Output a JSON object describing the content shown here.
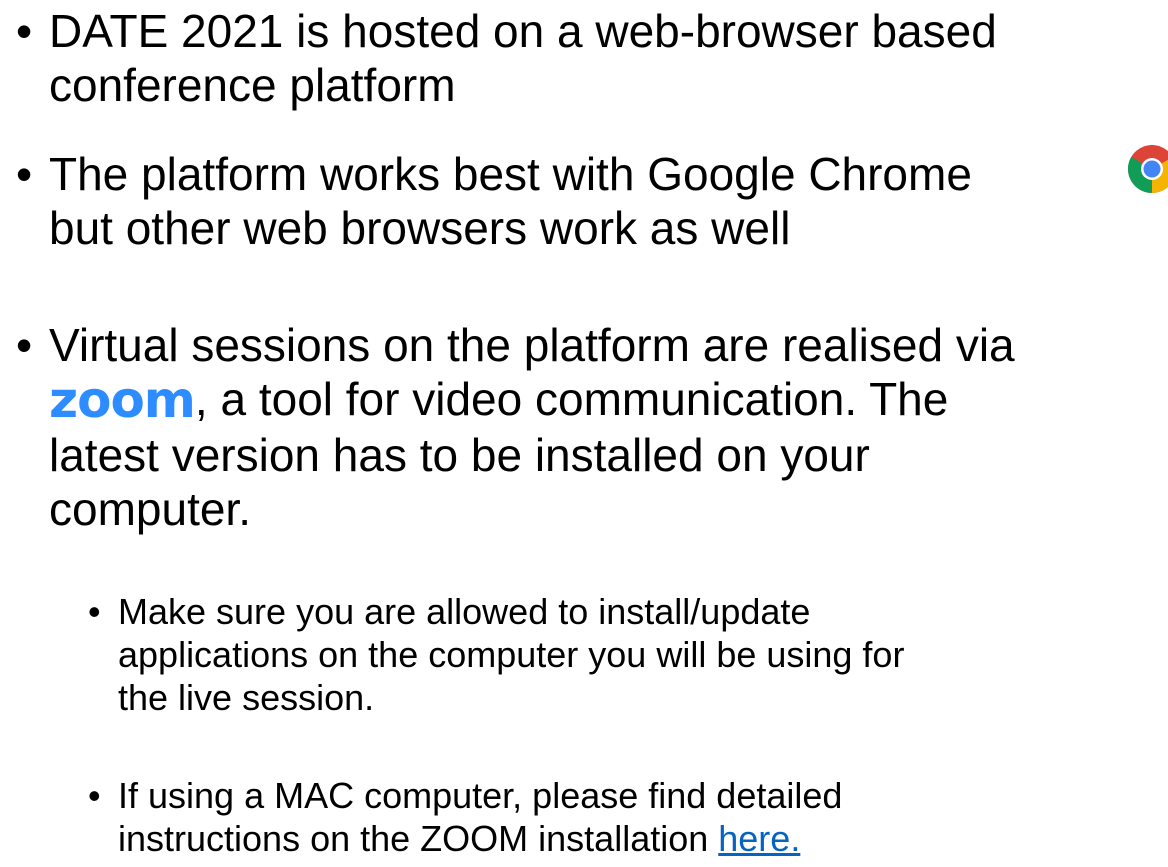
{
  "bullets": [
    {
      "lines": [
        "DATE 2021 is hosted on a web-browser based",
        "conference platform"
      ]
    },
    {
      "lines": [
        "The platform works best with Google Chrome",
        "but other web browsers work as well"
      ]
    },
    {
      "line1": "Virtual sessions on the platform are realised via",
      "logo_text": "zoom",
      "line2_rest": ", a tool for video communication. The",
      "line3": "latest version has to be installed on your",
      "line4": "computer."
    }
  ],
  "sub_bullets": [
    {
      "lines": [
        "Make sure you are allowed to install/update",
        "applications on the computer you will be using for",
        "the live session."
      ]
    },
    {
      "line1": "If using a MAC computer, please find detailed",
      "line2": "instructions on the ZOOM installation ",
      "link_text": "here."
    }
  ],
  "bullet_glyph": "•",
  "icons": {
    "chrome": "chrome-icon",
    "zoom": "zoom-logo"
  },
  "colors": {
    "zoom_blue": "#2D8CFF",
    "link": "#0563C1"
  }
}
